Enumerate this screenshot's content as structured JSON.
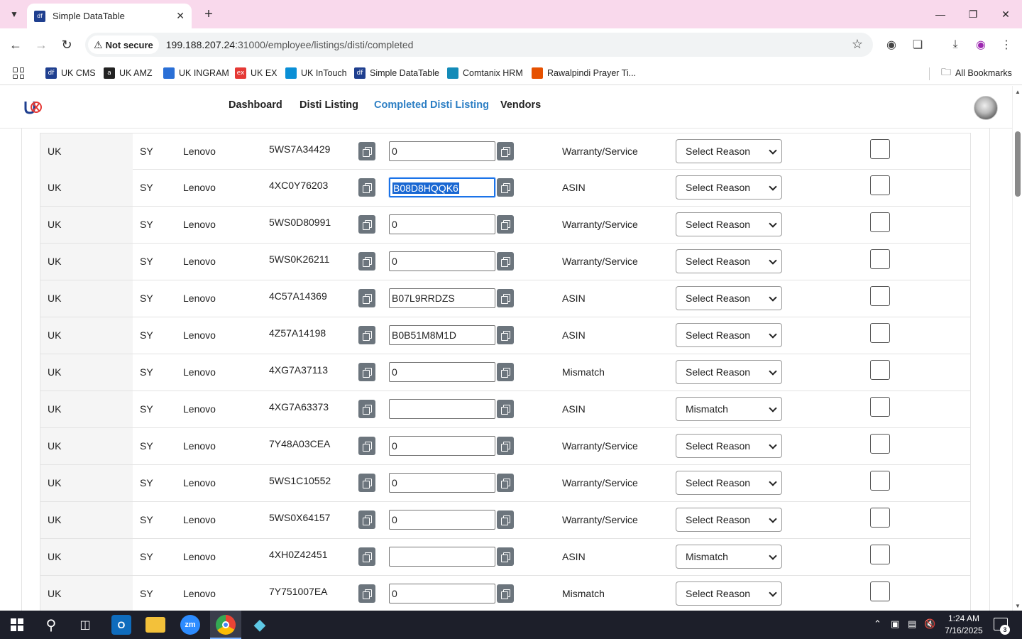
{
  "browser": {
    "tab_title": "Simple DataTable",
    "tab_favicon_text": "df",
    "security_label": "Not secure",
    "url_host": "199.188.207.24",
    "url_path": ":31000/employee/listings/disti/completed",
    "bookmarks": [
      {
        "label": "UK CMS",
        "icon_text": "df",
        "color": "#1f3f8f"
      },
      {
        "label": "UK AMZ",
        "icon_text": "a",
        "color": "#222222"
      },
      {
        "label": "UK INGRAM",
        "icon_text": "",
        "color": "#2a6fd6"
      },
      {
        "label": "UK EX",
        "icon_text": "ex",
        "color": "#e53935"
      },
      {
        "label": "UK InTouch",
        "icon_text": "",
        "color": "#0a8fd6"
      },
      {
        "label": "Simple DataTable",
        "icon_text": "df",
        "color": "#1f3f8f"
      },
      {
        "label": "Comtanix HRM",
        "icon_text": "",
        "color": "#138bb8"
      },
      {
        "label": "Rawalpindi Prayer Ti...",
        "icon_text": "",
        "color": "#e65100"
      }
    ],
    "all_bookmarks_label": "All Bookmarks"
  },
  "app": {
    "nav": [
      {
        "label": "Dashboard",
        "active": false
      },
      {
        "label": "Disti Listing",
        "active": false
      },
      {
        "label": "Completed Disti Listing",
        "active": true
      },
      {
        "label": "Vendors",
        "active": false
      }
    ],
    "accent_color": "#2d7fc4"
  },
  "table": {
    "rows": [
      {
        "country": "UK",
        "code": "SY",
        "brand": "Lenovo",
        "sku": "5WS7A34429",
        "value": "0",
        "type": "Warranty/Service",
        "reason": "Select Reason",
        "focused": false
      },
      {
        "country": "UK",
        "code": "SY",
        "brand": "Lenovo",
        "sku": "4XC0Y76203",
        "value": "B08D8HQQK6",
        "type": "ASIN",
        "reason": "Select Reason",
        "focused": true
      },
      {
        "country": "UK",
        "code": "SY",
        "brand": "Lenovo",
        "sku": "5WS0D80991",
        "value": "0",
        "type": "Warranty/Service",
        "reason": "Select Reason",
        "focused": false
      },
      {
        "country": "UK",
        "code": "SY",
        "brand": "Lenovo",
        "sku": "5WS0K26211",
        "value": "0",
        "type": "Warranty/Service",
        "reason": "Select Reason",
        "focused": false
      },
      {
        "country": "UK",
        "code": "SY",
        "brand": "Lenovo",
        "sku": "4C57A14369",
        "value": "B07L9RRDZS",
        "type": "ASIN",
        "reason": "Select Reason",
        "focused": false
      },
      {
        "country": "UK",
        "code": "SY",
        "brand": "Lenovo",
        "sku": "4Z57A14198",
        "value": "B0B51M8M1D",
        "type": "ASIN",
        "reason": "Select Reason",
        "focused": false
      },
      {
        "country": "UK",
        "code": "SY",
        "brand": "Lenovo",
        "sku": "4XG7A37113",
        "value": "0",
        "type": "Mismatch",
        "reason": "Select Reason",
        "focused": false
      },
      {
        "country": "UK",
        "code": "SY",
        "brand": "Lenovo",
        "sku": "4XG7A63373",
        "value": "",
        "type": "ASIN",
        "reason": "Mismatch",
        "focused": false
      },
      {
        "country": "UK",
        "code": "SY",
        "brand": "Lenovo",
        "sku": "7Y48A03CEA",
        "value": "0",
        "type": "Warranty/Service",
        "reason": "Select Reason",
        "focused": false
      },
      {
        "country": "UK",
        "code": "SY",
        "brand": "Lenovo",
        "sku": "5WS1C10552",
        "value": "0",
        "type": "Warranty/Service",
        "reason": "Select Reason",
        "focused": false
      },
      {
        "country": "UK",
        "code": "SY",
        "brand": "Lenovo",
        "sku": "5WS0X64157",
        "value": "0",
        "type": "Warranty/Service",
        "reason": "Select Reason",
        "focused": false
      },
      {
        "country": "UK",
        "code": "SY",
        "brand": "Lenovo",
        "sku": "4XH0Z42451",
        "value": "",
        "type": "ASIN",
        "reason": "Mismatch",
        "focused": false
      },
      {
        "country": "UK",
        "code": "SY",
        "brand": "Lenovo",
        "sku": "7Y751007EA",
        "value": "0",
        "type": "Mismatch",
        "reason": "Select Reason",
        "focused": false
      }
    ]
  },
  "taskbar": {
    "time": "1:24 AM",
    "date": "7/16/2025",
    "notification_count": "3"
  }
}
